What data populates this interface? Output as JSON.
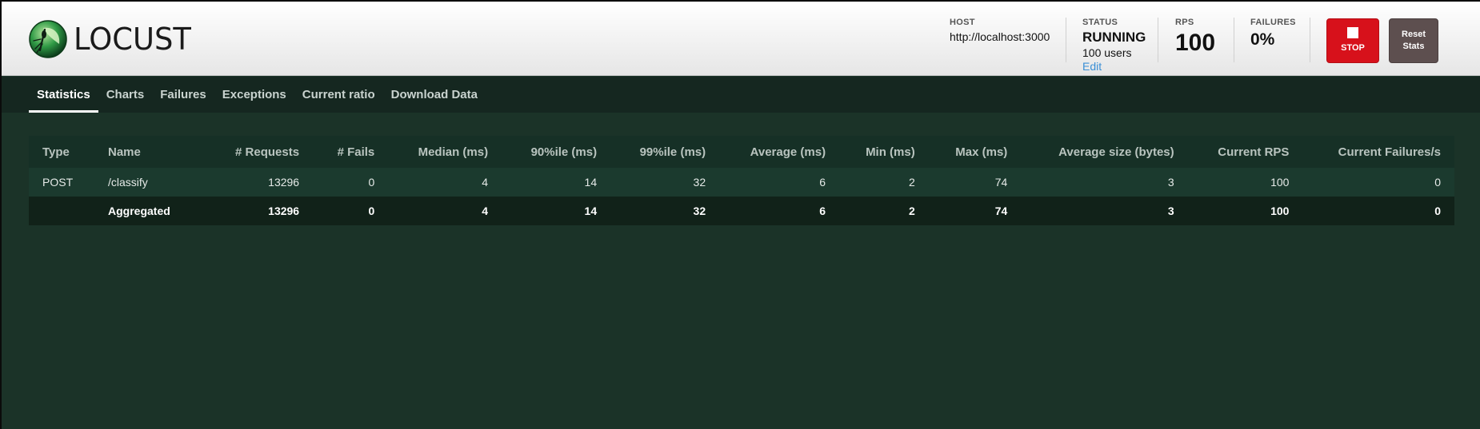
{
  "brand": {
    "logo_text": "LOCUST"
  },
  "header": {
    "host": {
      "label": "HOST",
      "value": "http://localhost:3000"
    },
    "status": {
      "label": "STATUS",
      "value": "RUNNING",
      "users": "100 users",
      "edit_label": "Edit"
    },
    "rps": {
      "label": "RPS",
      "value": "100"
    },
    "failures": {
      "label": "FAILURES",
      "value": "0%"
    },
    "stop_label": "STOP",
    "reset_label_line1": "Reset",
    "reset_label_line2": "Stats"
  },
  "nav": {
    "tabs": [
      {
        "label": "Statistics",
        "active": true
      },
      {
        "label": "Charts"
      },
      {
        "label": "Failures"
      },
      {
        "label": "Exceptions"
      },
      {
        "label": "Current ratio"
      },
      {
        "label": "Download Data"
      }
    ]
  },
  "table": {
    "headers": [
      "Type",
      "Name",
      "# Requests",
      "# Fails",
      "Median (ms)",
      "90%ile (ms)",
      "99%ile (ms)",
      "Average (ms)",
      "Min (ms)",
      "Max (ms)",
      "Average size (bytes)",
      "Current RPS",
      "Current Failures/s"
    ],
    "rows": [
      [
        "POST",
        "/classify",
        "13296",
        "0",
        "4",
        "14",
        "32",
        "6",
        "2",
        "74",
        "3",
        "100",
        "0"
      ]
    ],
    "aggregated": [
      "",
      "Aggregated",
      "13296",
      "0",
      "4",
      "14",
      "32",
      "6",
      "2",
      "74",
      "3",
      "100",
      "0"
    ]
  },
  "colors": {
    "background": "#1b3328",
    "stop_button": "#d7111b",
    "reset_button": "#5d4f4f",
    "edit_link": "#3a8fd6"
  }
}
